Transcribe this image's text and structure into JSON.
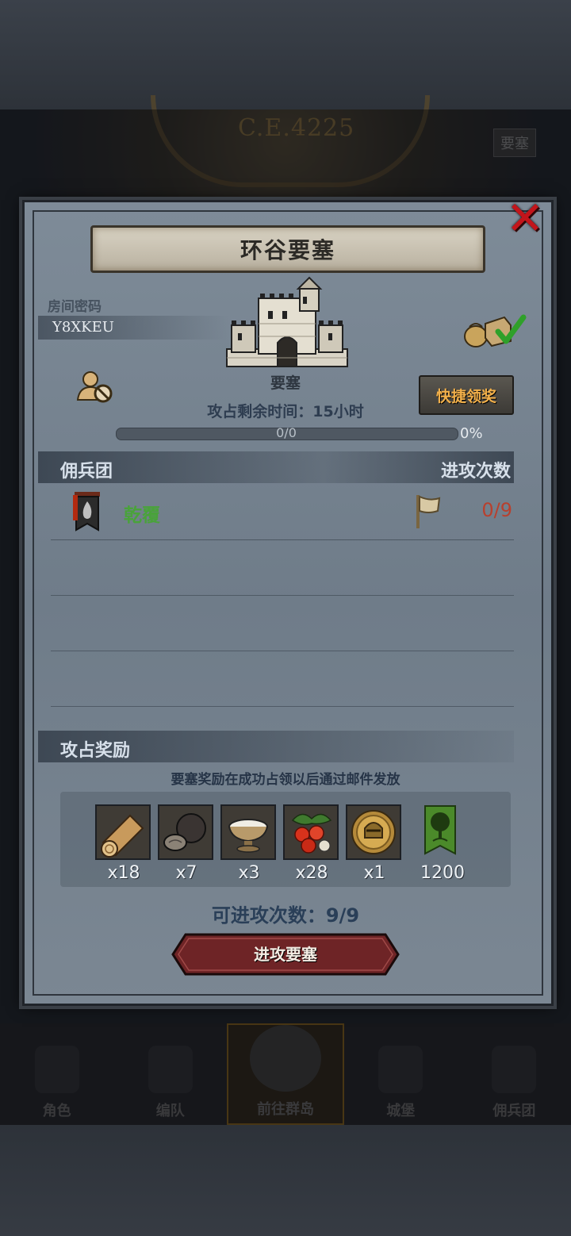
{
  "background": {
    "era_text": "C.E.4225",
    "top_tag": "要塞"
  },
  "bottom_nav": [
    {
      "label": "角色",
      "icon": "knight-icon",
      "active": false
    },
    {
      "label": "编队",
      "icon": "armor-icon",
      "active": false
    },
    {
      "label": "前往群岛",
      "icon": "globe-icon",
      "active": true
    },
    {
      "label": "城堡",
      "icon": "castle-icon",
      "active": false
    },
    {
      "label": "佣兵团",
      "icon": "banner-icon",
      "active": false
    }
  ],
  "modal": {
    "title": "环谷要塞",
    "room": {
      "label": "房间密码",
      "code": "Y8XKEU"
    },
    "fortress": {
      "label": "要塞",
      "icon": "fortress-icon"
    },
    "quick_claim_label": "快捷领奖",
    "time_remaining": "攻占剩余时间：15小时",
    "progress": {
      "text": "0/0",
      "percent_text": "0%",
      "value": 0
    },
    "mercenaries": {
      "header_left": "佣兵团",
      "header_right": "进攻次数",
      "rows": [
        {
          "name": "乾覆",
          "attacks": "0/9",
          "emblem": "flame-banner-icon",
          "flag": "white-flag-icon"
        }
      ]
    },
    "rewards": {
      "header": "攻占奖励",
      "note": "要塞奖励在成功占领以后通过邮件发放",
      "items": [
        {
          "icon": "wood-log-icon",
          "qty": "x18"
        },
        {
          "icon": "truffle-icon",
          "qty": "x7"
        },
        {
          "icon": "milk-bowl-icon",
          "qty": "x3"
        },
        {
          "icon": "berries-icon",
          "qty": "x28"
        },
        {
          "icon": "knight-medal-icon",
          "qty": "x1"
        },
        {
          "icon": "tree-banner-icon",
          "qty": "1200"
        }
      ]
    },
    "attack_count": "可进攻次数：9/9",
    "attack_button": "进攻要塞"
  },
  "colors": {
    "accent_gold": "#f2b04a",
    "merc_name_green": "#49a33a",
    "attack_count_red": "#b8402e",
    "button_red": "#6e2426"
  }
}
